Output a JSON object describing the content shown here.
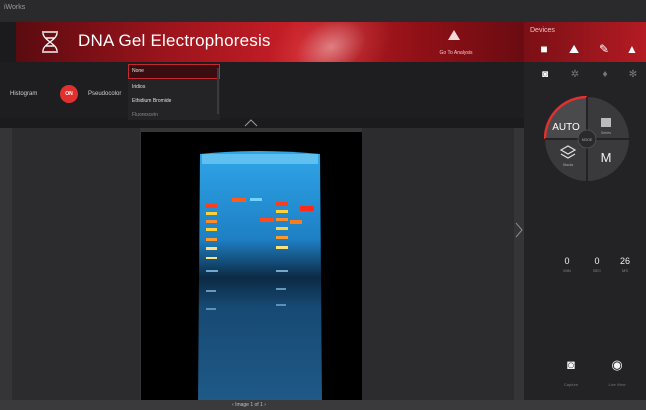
{
  "window": {
    "app_name": "iWorks"
  },
  "header": {
    "title": "DNA Gel Electrophoresis",
    "go_analysis_label": "Go To Analysis"
  },
  "devices": {
    "label": "Devices"
  },
  "toolbar": {
    "histogram_label": "Histogram",
    "histogram_toggle": "ON",
    "pseudocolor_label": "Pseudocolor"
  },
  "dropdown": {
    "options": [
      "None",
      "Iridios",
      "Ethidium Bromide",
      "Fluorescein"
    ],
    "selected_index": 0
  },
  "mode_dial": {
    "auto_label": "AUTO",
    "series_label": "Series",
    "stacks_label": "Stacks",
    "manual_label": "M",
    "center_label": "MODE"
  },
  "readouts": [
    {
      "value": "0",
      "unit": "MIN"
    },
    {
      "value": "0",
      "unit": "SEC"
    },
    {
      "value": "26",
      "unit": "MS"
    }
  ],
  "capture": {
    "label": "Capture"
  },
  "live_view": {
    "label": "Live View"
  },
  "pager": {
    "text": "Image 1 of 1"
  },
  "colors": {
    "accent_red": "#c71e27",
    "toggle_red": "#e0312f",
    "gel_blue": "#1e7fc4",
    "band_hot": "#ff3b1a",
    "band_warm": "#ffd23a"
  }
}
